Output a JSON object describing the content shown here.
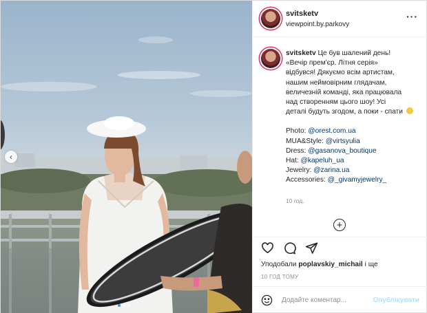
{
  "post": {
    "username": "svitsketv",
    "location": "viewpoint.by.parkovy",
    "more_icon": "more-icon",
    "caption_text": "Це був шалений день!\n«Вечір прем'єр. Літня серія»\nвідбувся! Дякуємо всім артистам,\nнашим неймовірним глядачам,\nвеличезній команді, яка працювала\nнад створенням цього шоу! Усі\nдеталі будуть згодом, а поки - спати",
    "credits": [
      {
        "label": "Photo: ",
        "handle": "@orest.com.ua"
      },
      {
        "label": "MUA&Style: ",
        "handle": "@virtsyulia"
      },
      {
        "label": "Dress: ",
        "handle": "@gasanova_boutique"
      },
      {
        "label": "Hat: ",
        "handle": "@kapeluh_ua"
      },
      {
        "label": "Jewelry: ",
        "handle": "@zarina.ua"
      },
      {
        "label": "Accessories: ",
        "handle": "@_givamyjewelry_"
      }
    ],
    "caption_time": "10 год.",
    "likes_prefix": "Уподобали ",
    "likes_user": "poplavskiy_michail",
    "likes_suffix": " і ще",
    "timestamp": "10 ГОД ТОМУ",
    "comment_placeholder": "Додайте коментар...",
    "publish_label": "Опублікувати",
    "carousel": {
      "total_slides": 3,
      "active_slide": 1
    }
  },
  "colors": {
    "link": "#00376b",
    "publish_disabled": "#b2dffc",
    "story_ring": "#e1306c",
    "carousel_active": "#3897f0"
  },
  "icons": [
    "chevron-left-icon",
    "heart-icon",
    "comment-icon",
    "share-icon",
    "plus-circle-icon",
    "smile-icon"
  ]
}
